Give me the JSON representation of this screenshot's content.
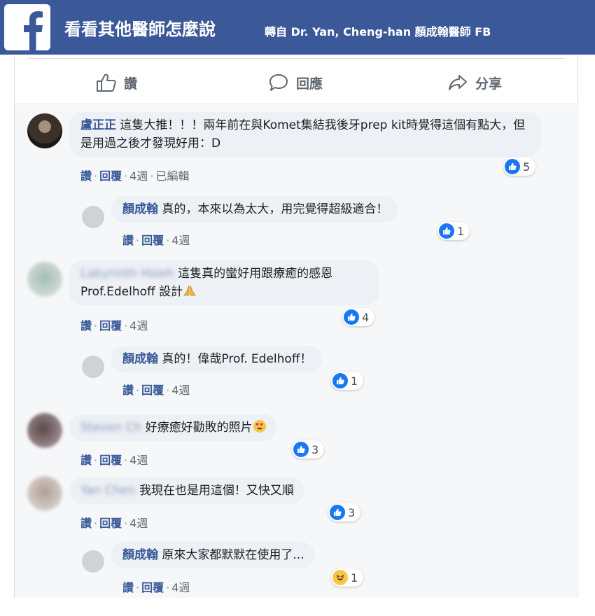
{
  "header": {
    "title": "看看其他醫師怎麼說",
    "source": "轉自 Dr. Yan, Cheng-han 顏成翰醫師 FB",
    "icon": "facebook-logo-icon",
    "bg_color": "#3b5998"
  },
  "actions": {
    "like": "讚",
    "reply": "回應",
    "share": "分享"
  },
  "meta_labels": {
    "like": "讚",
    "reply": "回覆",
    "edited": "已編輯"
  },
  "comments": [
    {
      "author": "盧正正",
      "text": "這隻大推！！！兩年前在與Komet集結我後牙prep kit時覺得這個有點大，但是用過之後才發現好用：D",
      "time": "4週",
      "reaction_count": "5",
      "reaction": "like",
      "reply": {
        "author": "顏成翰",
        "text": "真的，本來以為太大，用完覺得超級適合！",
        "time": "4週",
        "reaction_count": "1",
        "reaction": "like"
      }
    },
    {
      "author": "Labyrinth Hsieh",
      "text": "這隻真的蠻好用跟療癒的感恩 Prof.Edelhoff 設計",
      "time": "4週",
      "reaction_count": "4",
      "reaction": "like",
      "reply": {
        "author": "顏成翰",
        "text": "真的！偉哉Prof. Edelhoff！",
        "time": "4週",
        "reaction_count": "1",
        "reaction": "like"
      }
    },
    {
      "author": "Steven Ch",
      "text": "好療癒好勸敗的照片",
      "time": "4週",
      "reaction_count": "3",
      "reaction": "like"
    },
    {
      "author": "Yan Chen",
      "text": "我現在也是用這個！又快又順",
      "time": "4週",
      "reaction_count": "3",
      "reaction": "like",
      "reply": {
        "author": "顏成翰",
        "text": "原來大家都默默在使用了...",
        "time": "4週",
        "reaction_count": "1",
        "reaction": "haha"
      }
    }
  ]
}
